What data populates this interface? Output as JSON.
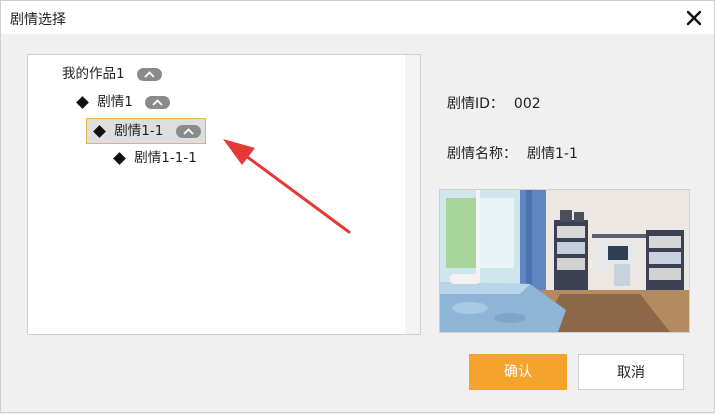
{
  "dialog": {
    "title": "剧情选择"
  },
  "tree": {
    "root": {
      "label": "我的作品1",
      "expanded": true
    },
    "level1": {
      "label": "剧情1",
      "expanded": true
    },
    "level2": {
      "label": "剧情1-1",
      "expanded": true,
      "selected": true
    },
    "level3": {
      "label": "剧情1-1-1"
    }
  },
  "details": {
    "id_label": "剧情ID：",
    "id_value": "002",
    "name_label": "剧情名称：",
    "name_value": "剧情1-1"
  },
  "buttons": {
    "ok": "确认",
    "cancel": "取消"
  },
  "icons": {
    "close": "close-icon",
    "collapse": "chevron-up-icon",
    "node": "diamond-node-icon",
    "annotation": "red-arrow"
  },
  "colors": {
    "accent": "#f4a42c",
    "selection_border": "#e8b64b",
    "annotation_arrow": "#e53935"
  }
}
